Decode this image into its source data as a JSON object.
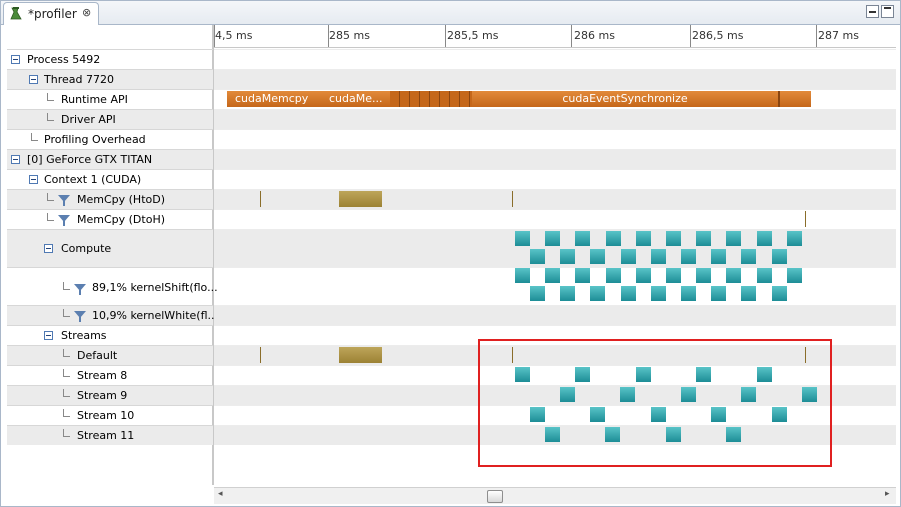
{
  "tab": {
    "title": "*profiler",
    "close": "⊗"
  },
  "icons": {
    "tab_icon": "profiler-flask-icon",
    "minimize": "minimize-icon",
    "maximize": "maximize-icon",
    "expand": "tree-expander-icon",
    "filter": "filter-funnel-icon"
  },
  "ruler": {
    "labels": [
      "4,5 ms",
      "285 ms",
      "285,5 ms",
      "286 ms",
      "286,5 ms",
      "287 ms"
    ]
  },
  "tree": {
    "process": "Process 5492",
    "thread": "Thread 7720",
    "runtime_api": "Runtime API",
    "driver_api": "Driver API",
    "profiling_overhead": "Profiling Overhead",
    "device": "[0] GeForce GTX TITAN",
    "context": "Context 1 (CUDA)",
    "memcpy_htod": "MemCpy (HtoD)",
    "memcpy_dtoh": "MemCpy (DtoH)",
    "compute": "Compute",
    "kernel_shift": "89,1% kernelShift(flo...",
    "kernel_white": "10,9% kernelWhite(fl...",
    "streams": "Streams",
    "stream_default": "Default",
    "stream_8": "Stream 8",
    "stream_9": "Stream 9",
    "stream_10": "Stream 10",
    "stream_11": "Stream 11"
  },
  "timeline": {
    "runtime_labels": [
      "cudaMemcpy",
      "cudaMe...",
      "cudaEventSynchronize"
    ]
  },
  "colors": {
    "api": "#d47a2a",
    "memcpy": "#ae9446",
    "kernel": "#3aa8b0",
    "highlight": "#e02020"
  }
}
